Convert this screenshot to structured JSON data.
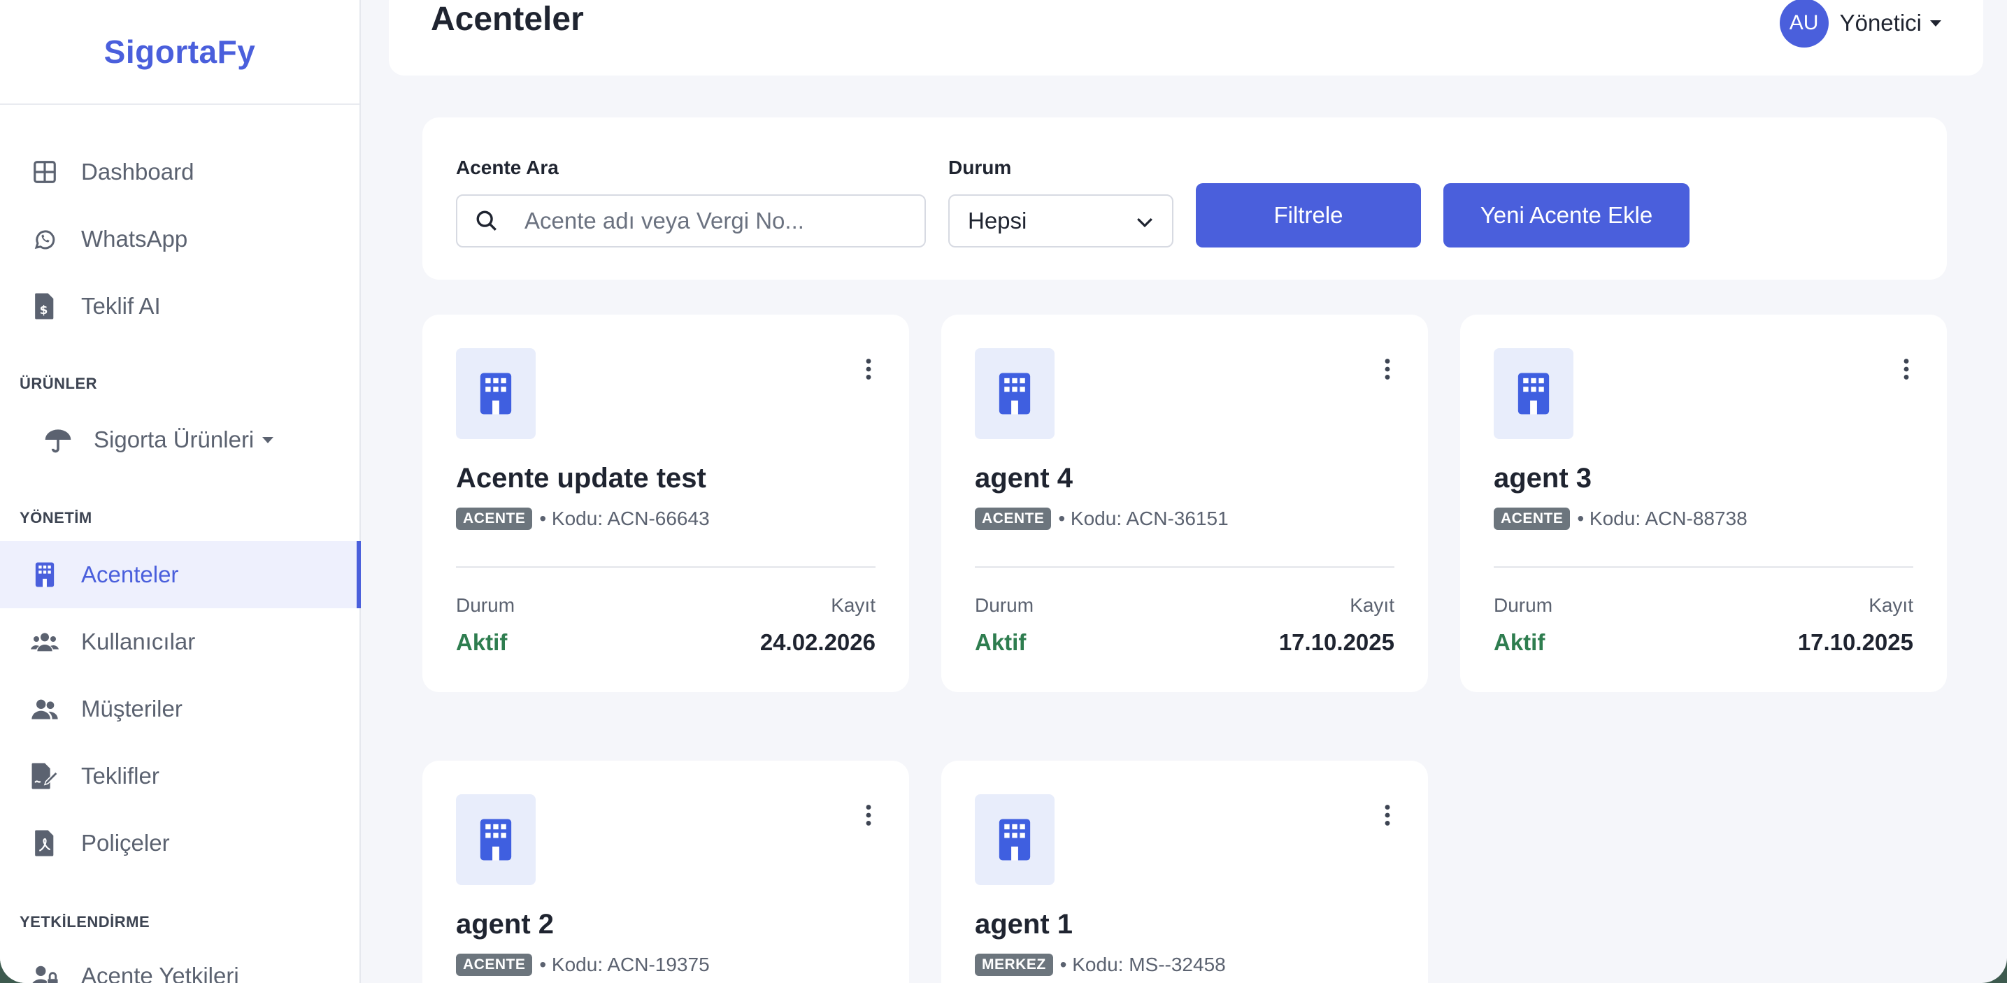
{
  "brand": "SigortaFy",
  "sidebar": {
    "items": [
      {
        "label": "Dashboard"
      },
      {
        "label": "WhatsApp"
      },
      {
        "label": "Teklif AI"
      },
      {
        "label": "Acenteler"
      },
      {
        "label": "Kullanıcılar"
      },
      {
        "label": "Müşteriler"
      },
      {
        "label": "Teklifler"
      },
      {
        "label": "Poliçeler"
      },
      {
        "label": "Acente Yetkileri"
      }
    ],
    "sections": {
      "products": "ÜRÜNLER",
      "management": "YÖNETİM",
      "authorization": "YETKİLENDİRME"
    },
    "products_item": "Sigorta Ürünleri"
  },
  "header": {
    "title": "Acenteler",
    "avatar_initials": "AU",
    "user_role": "Yönetici"
  },
  "filter": {
    "search_label": "Acente Ara",
    "search_placeholder": "Acente adı veya Vergi No...",
    "status_label": "Durum",
    "status_value": "Hepsi",
    "filter_button": "Filtrele",
    "add_button": "Yeni Acente Ekle"
  },
  "cards": [
    {
      "name": "Acente update test",
      "badge": "ACENTE",
      "code": "• Kodu: ACN-66643",
      "status_label": "Durum",
      "status": "Aktif",
      "date_label": "Kayıt",
      "date": "24.02.2026"
    },
    {
      "name": "agent 4",
      "badge": "ACENTE",
      "code": "• Kodu: ACN-36151",
      "status_label": "Durum",
      "status": "Aktif",
      "date_label": "Kayıt",
      "date": "17.10.2025"
    },
    {
      "name": "agent 3",
      "badge": "ACENTE",
      "code": "• Kodu: ACN-88738",
      "status_label": "Durum",
      "status": "Aktif",
      "date_label": "Kayıt",
      "date": "17.10.2025"
    },
    {
      "name": "agent 2",
      "badge": "ACENTE",
      "code": "• Kodu: ACN-19375"
    },
    {
      "name": "agent 1",
      "badge": "MERKEZ",
      "code": "• Kodu: MS--32458"
    }
  ],
  "colors": {
    "accent": "#4a5fdc",
    "active_status": "#2e7d4f",
    "badge": "#6c757d",
    "icon_tile": "#e8edfb"
  }
}
